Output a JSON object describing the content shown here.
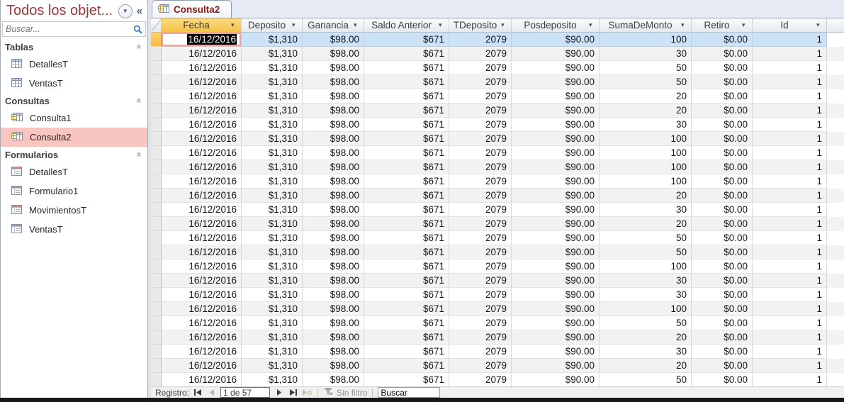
{
  "sidebar": {
    "title": "Todos los objet...",
    "search_placeholder": "Buscar...",
    "sections": [
      {
        "label": "Tablas",
        "items": [
          {
            "label": "DetallesT",
            "icon": "table-icon",
            "selected": false
          },
          {
            "label": "VentasT",
            "icon": "table-icon",
            "selected": false
          }
        ]
      },
      {
        "label": "Consultas",
        "items": [
          {
            "label": "Consulta1",
            "icon": "query-icon",
            "selected": false
          },
          {
            "label": "Consulta2",
            "icon": "query-icon",
            "selected": true
          }
        ]
      },
      {
        "label": "Formularios",
        "items": [
          {
            "label": "DetallesT",
            "icon": "form-icon",
            "selected": false
          },
          {
            "label": "Formulario1",
            "icon": "form-icon",
            "selected": false
          },
          {
            "label": "MovimientosT",
            "icon": "form-icon",
            "selected": false
          },
          {
            "label": "VentasT",
            "icon": "form-icon",
            "selected": false
          }
        ]
      }
    ]
  },
  "tab": {
    "label": "Consulta2",
    "icon": "query-icon"
  },
  "datasheet": {
    "columns": [
      "Fecha",
      "Deposito",
      "Ganancia",
      "Saldo Anterior",
      "TDeposito",
      "Posdeposito",
      "SumaDeMonto",
      "Retiro",
      "Id"
    ],
    "active_column": "Fecha",
    "selected_cell": {
      "row": 1,
      "column": "Fecha",
      "value": "16/12/2016"
    },
    "rows": [
      [
        "16/12/2016",
        "$1,310",
        "$98.00",
        "$671",
        "2079",
        "$90.00",
        "100",
        "$0.00",
        "1"
      ],
      [
        "16/12/2016",
        "$1,310",
        "$98.00",
        "$671",
        "2079",
        "$90.00",
        "30",
        "$0.00",
        "1"
      ],
      [
        "16/12/2016",
        "$1,310",
        "$98.00",
        "$671",
        "2079",
        "$90.00",
        "50",
        "$0.00",
        "1"
      ],
      [
        "16/12/2016",
        "$1,310",
        "$98.00",
        "$671",
        "2079",
        "$90.00",
        "50",
        "$0.00",
        "1"
      ],
      [
        "16/12/2016",
        "$1,310",
        "$98.00",
        "$671",
        "2079",
        "$90.00",
        "20",
        "$0.00",
        "1"
      ],
      [
        "16/12/2016",
        "$1,310",
        "$98.00",
        "$671",
        "2079",
        "$90.00",
        "20",
        "$0.00",
        "1"
      ],
      [
        "16/12/2016",
        "$1,310",
        "$98.00",
        "$671",
        "2079",
        "$90.00",
        "30",
        "$0.00",
        "1"
      ],
      [
        "16/12/2016",
        "$1,310",
        "$98.00",
        "$671",
        "2079",
        "$90.00",
        "100",
        "$0.00",
        "1"
      ],
      [
        "16/12/2016",
        "$1,310",
        "$98.00",
        "$671",
        "2079",
        "$90.00",
        "100",
        "$0.00",
        "1"
      ],
      [
        "16/12/2016",
        "$1,310",
        "$98.00",
        "$671",
        "2079",
        "$90.00",
        "100",
        "$0.00",
        "1"
      ],
      [
        "16/12/2016",
        "$1,310",
        "$98.00",
        "$671",
        "2079",
        "$90.00",
        "100",
        "$0.00",
        "1"
      ],
      [
        "16/12/2016",
        "$1,310",
        "$98.00",
        "$671",
        "2079",
        "$90.00",
        "20",
        "$0.00",
        "1"
      ],
      [
        "16/12/2016",
        "$1,310",
        "$98.00",
        "$671",
        "2079",
        "$90.00",
        "30",
        "$0.00",
        "1"
      ],
      [
        "16/12/2016",
        "$1,310",
        "$98.00",
        "$671",
        "2079",
        "$90.00",
        "20",
        "$0.00",
        "1"
      ],
      [
        "16/12/2016",
        "$1,310",
        "$98.00",
        "$671",
        "2079",
        "$90.00",
        "50",
        "$0.00",
        "1"
      ],
      [
        "16/12/2016",
        "$1,310",
        "$98.00",
        "$671",
        "2079",
        "$90.00",
        "50",
        "$0.00",
        "1"
      ],
      [
        "16/12/2016",
        "$1,310",
        "$98.00",
        "$671",
        "2079",
        "$90.00",
        "100",
        "$0.00",
        "1"
      ],
      [
        "16/12/2016",
        "$1,310",
        "$98.00",
        "$671",
        "2079",
        "$90.00",
        "30",
        "$0.00",
        "1"
      ],
      [
        "16/12/2016",
        "$1,310",
        "$98.00",
        "$671",
        "2079",
        "$90.00",
        "30",
        "$0.00",
        "1"
      ],
      [
        "16/12/2016",
        "$1,310",
        "$98.00",
        "$671",
        "2079",
        "$90.00",
        "100",
        "$0.00",
        "1"
      ],
      [
        "16/12/2016",
        "$1,310",
        "$98.00",
        "$671",
        "2079",
        "$90.00",
        "50",
        "$0.00",
        "1"
      ],
      [
        "16/12/2016",
        "$1,310",
        "$98.00",
        "$671",
        "2079",
        "$90.00",
        "20",
        "$0.00",
        "1"
      ],
      [
        "16/12/2016",
        "$1,310",
        "$98.00",
        "$671",
        "2079",
        "$90.00",
        "30",
        "$0.00",
        "1"
      ],
      [
        "16/12/2016",
        "$1,310",
        "$98.00",
        "$671",
        "2079",
        "$90.00",
        "20",
        "$0.00",
        "1"
      ],
      [
        "16/12/2016",
        "$1,310",
        "$98.00",
        "$671",
        "2079",
        "$90.00",
        "50",
        "$0.00",
        "1"
      ]
    ]
  },
  "record_nav": {
    "label": "Registro:",
    "position": "1 de 57",
    "filter_status": "Sin filtro",
    "search_box": "Buscar",
    "icons": [
      "first-record-icon",
      "previous-record-icon",
      "next-record-icon",
      "last-record-icon",
      "new-record-icon",
      "filter-icon"
    ]
  },
  "colors": {
    "selection_blue": "#cbe2f7",
    "active_column_amber": "#f4c24a",
    "nav_selected_pink": "#f9c5c0",
    "title_red": "#9a3938",
    "tab_text_red": "#8b1d12"
  }
}
